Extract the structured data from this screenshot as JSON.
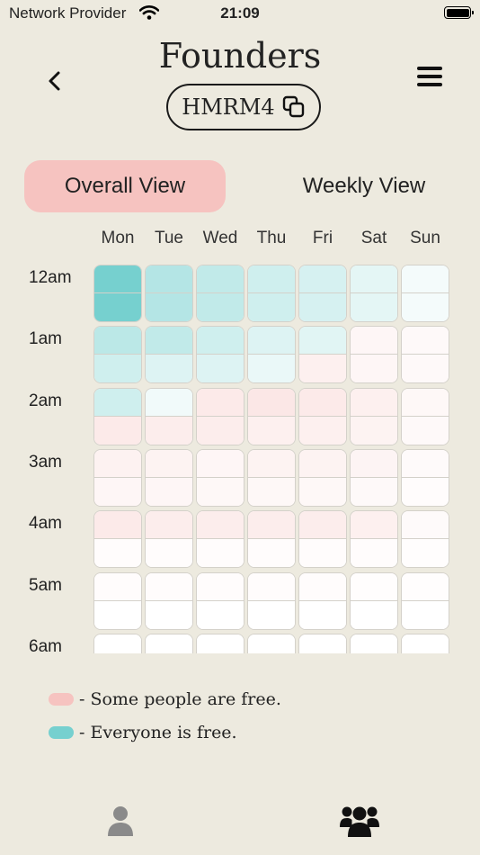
{
  "status_bar": {
    "carrier": "Network Provider",
    "time": "21:09"
  },
  "header": {
    "title": "Founders",
    "group_code": "HMRM4"
  },
  "view_toggle": {
    "overall": "Overall View",
    "weekly": "Weekly View",
    "selected": "overall"
  },
  "days": [
    "Mon",
    "Tue",
    "Wed",
    "Thu",
    "Fri",
    "Sat",
    "Sun"
  ],
  "hours": [
    "12am",
    "1am",
    "2am",
    "3am",
    "4am",
    "5am",
    "6am"
  ],
  "colors": {
    "everyone_free": "#76D0CF",
    "some_free": "#F6C3C0",
    "background": "#EDEADF"
  },
  "availability_levels": [
    [
      1.0,
      0.55,
      0.45,
      0.35,
      0.3,
      0.2,
      0.08
    ],
    [
      1.0,
      0.55,
      0.45,
      0.35,
      0.3,
      0.2,
      0.08
    ],
    [
      0.5,
      0.45,
      0.35,
      0.25,
      0.22,
      -0.15,
      -0.1
    ],
    [
      0.35,
      0.25,
      0.25,
      0.15,
      -0.25,
      -0.15,
      -0.1
    ],
    [
      0.35,
      0.1,
      -0.35,
      -0.4,
      -0.35,
      -0.25,
      -0.12
    ],
    [
      -0.35,
      -0.3,
      -0.3,
      -0.25,
      -0.25,
      -0.2,
      -0.1
    ],
    [
      -0.22,
      -0.2,
      -0.15,
      -0.2,
      -0.2,
      -0.18,
      -0.08
    ],
    [
      -0.15,
      -0.15,
      -0.12,
      -0.12,
      -0.12,
      -0.1,
      -0.05
    ],
    [
      -0.35,
      -0.3,
      -0.3,
      -0.3,
      -0.3,
      -0.25,
      -0.08
    ],
    [
      -0.05,
      -0.05,
      -0.05,
      -0.05,
      -0.05,
      -0.05,
      -0.03
    ],
    [
      -0.05,
      -0.05,
      -0.05,
      -0.05,
      -0.05,
      -0.03,
      -0.03
    ],
    [
      0,
      0,
      0,
      0,
      0,
      0,
      0
    ],
    [
      0,
      0,
      0,
      0,
      0,
      0,
      0
    ],
    [
      0,
      0,
      0,
      0,
      0,
      0,
      0
    ]
  ],
  "legend": {
    "some": "- Some people are free.",
    "everyone": "- Everyone is free."
  },
  "tabs": {
    "profile_icon": "person-icon",
    "groups_icon": "users-icon"
  }
}
